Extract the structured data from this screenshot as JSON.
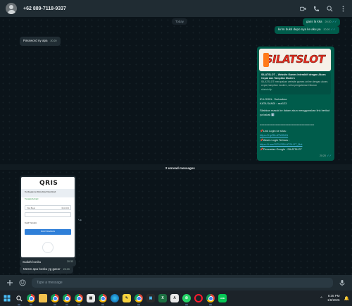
{
  "header": {
    "contact_name": "+62 889-7118-9337",
    "icons": [
      "avatar",
      "video-call-icon",
      "phone-icon",
      "search-icon",
      "menu-icon"
    ]
  },
  "chat": {
    "date_pill": "Today",
    "unread_pill": "2 unread messages",
    "messages": {
      "out1": {
        "text": "gass la kka",
        "time": "20:20"
      },
      "out2": {
        "text": "kirim bukti depo nya ke aku ya",
        "time": "20:20"
      },
      "in1": {
        "text": "Password ny apa",
        "time": "20:20"
      },
      "promo": {
        "logo": "SILATSLOT",
        "title": "SILATSLOT – Website Games Interaktif dengan Akses Cepat dan Tampilan Modern",
        "desc": "SILATSLOT merupakan website games online dengan akses cepat, tampilan modern, serta pengalaman hiburan",
        "domain": "silatslot.lp",
        "login_id": "ID LOGIN : Sorhadma",
        "password": "KATA SANDI : asd123",
        "instruction": "Silahkan masuk ke dalam akun menggunakan link berikut ya kakak ⬇️",
        "divider": "==================================",
        "link_label": "📌Link Login ke situs :",
        "link_url": "https://t.ly/SILATWIN01",
        "akses_label": "📌Akses Login Terbaru :",
        "akses_url": "https://t.me/SITUSSILATSLOT_Bot",
        "google_label": "📌Pencarian Google : SILATSLOT",
        "time": "20:20"
      },
      "in2": {
        "caption": "Sudah bosku",
        "time": "20:33"
      },
      "in3": {
        "text": "Mesm apa bosku yg gacor",
        "time": "20:33"
      }
    },
    "receipt": {
      "brand": "QRIS",
      "line1": "Pembayaran ke Warna Date Pulsa Murah",
      "status": "Transaksi berhasil",
      "field1": "Total Bayar",
      "field2": "Rp10.162",
      "field3": "Detail Transaksi",
      "button": "BUAT PESANAN"
    }
  },
  "composer": {
    "placeholder": "Type a message"
  },
  "taskbar": {
    "time": "8:35 PM",
    "date": "1/8/2026"
  }
}
